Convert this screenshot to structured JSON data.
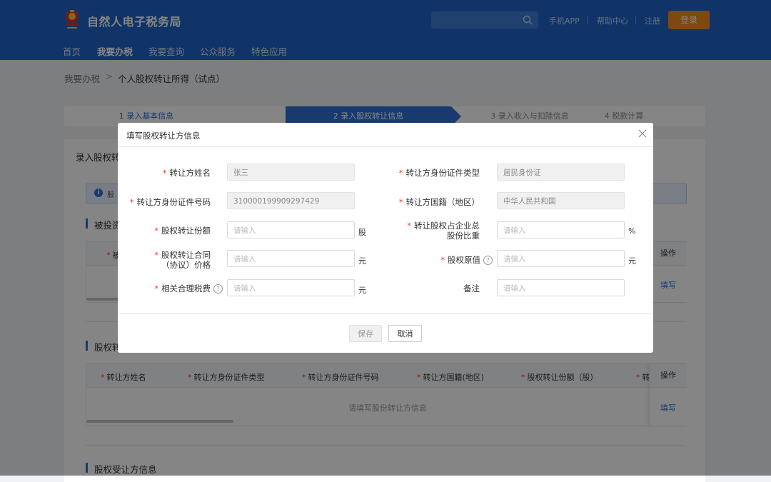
{
  "header": {
    "brand": "自然人电子税务局",
    "links": [
      "手机APP",
      "帮助中心",
      "注册"
    ],
    "login": "登录",
    "nav": [
      "首页",
      "我要办税",
      "我要查询",
      "公众服务",
      "特色应用"
    ]
  },
  "breadcrumb": {
    "root": "我要办税",
    "current": "个人股权转让所得（试点）"
  },
  "steps": [
    "1  录入基本信息",
    "2  录入股权转让信息",
    "3  录入收入与扣除信息",
    "4  税款计算"
  ],
  "page": {
    "card_title": "录入股权转",
    "info_text": "股",
    "section1_title": "被投资",
    "table1": {
      "first_header": "被",
      "op_header": "操作",
      "op_link": "填写"
    },
    "section2_title": "股权转",
    "table2": {
      "headers": [
        "转让方姓名",
        "转让方身份证件类型",
        "转让方身份证件号码",
        "转让方国籍(地区)",
        "股权转让份额（股）",
        "转"
      ],
      "empty": "请填写股份转让方信息",
      "op_header": "操作",
      "op_link": "填写"
    },
    "section3_title": "股权受让方信息"
  },
  "modal": {
    "title": "填写股权转让方信息",
    "fields": {
      "name_label": "转让方姓名",
      "name_value": "张三",
      "idtype_label": "转让方身份证件类型",
      "idtype_value": "居民身份证",
      "idno_label": "转让方身份证件号码",
      "idno_value": "310000199909297429",
      "nation_label": "转让方国籍（地区）",
      "nation_value": "中华人民共和国",
      "share_label": "股权转让份额",
      "share_unit": "股",
      "ratio_label": "转让股权占企业总股份比重",
      "ratio_unit": "%",
      "contract_label": "股权转让合同（协议）价格",
      "contract_unit": "元",
      "original_label": "股权原值",
      "original_unit": "元",
      "fee_label": "相关合理税费",
      "fee_unit": "元",
      "remark_label": "备注"
    },
    "placeholder": "请输入",
    "save": "保存",
    "cancel": "取消"
  }
}
